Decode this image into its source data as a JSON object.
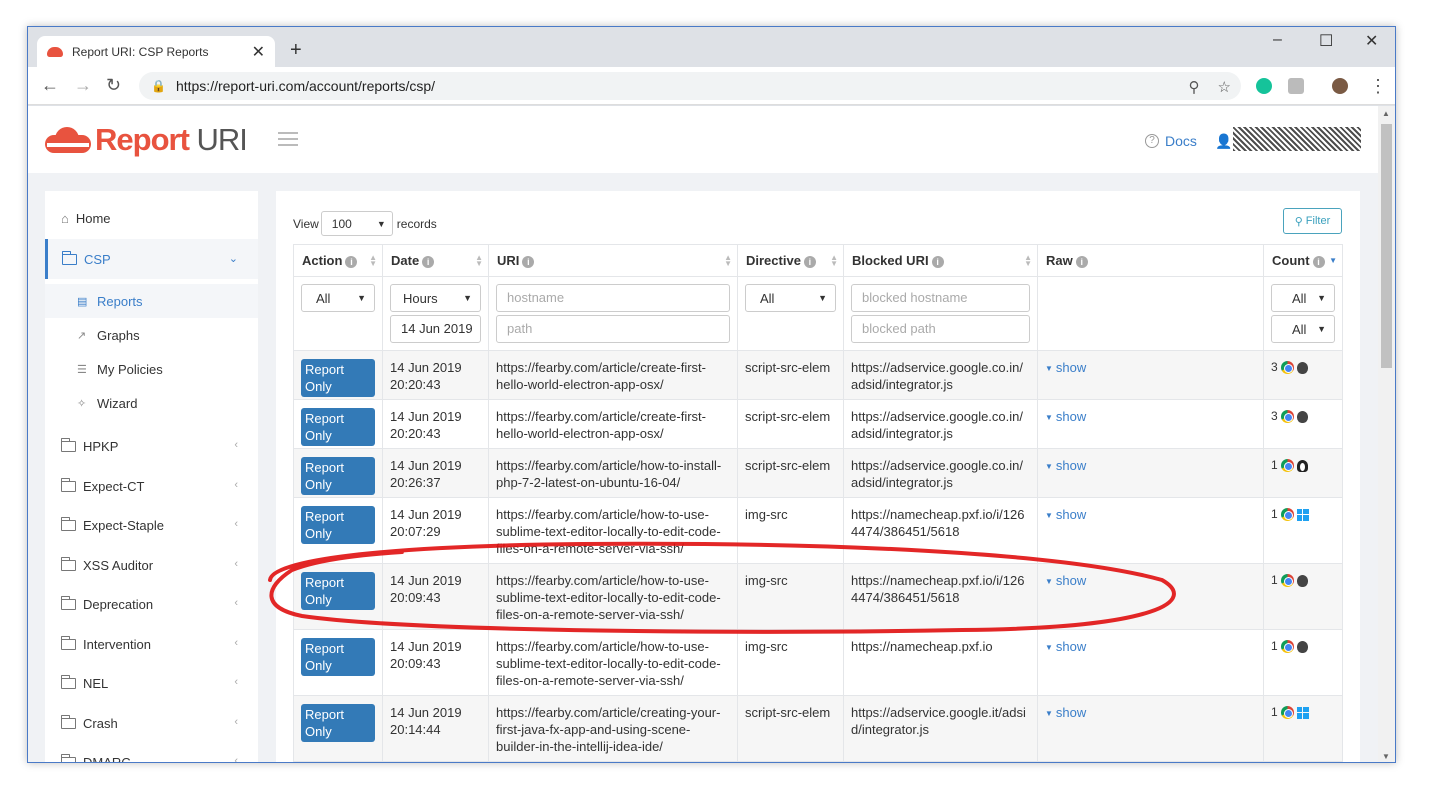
{
  "browser": {
    "tab_title": "Report URI: CSP Reports",
    "url": "https://report-uri.com/account/reports/csp/"
  },
  "header": {
    "brand_report": "Report",
    "brand_uri": " URI",
    "docs_label": "Docs"
  },
  "sidebar": {
    "items": [
      {
        "label": "Home"
      },
      {
        "label": "CSP"
      },
      {
        "label": "HPKP"
      },
      {
        "label": "Expect-CT"
      },
      {
        "label": "Expect-Staple"
      },
      {
        "label": "XSS Auditor"
      },
      {
        "label": "Deprecation"
      },
      {
        "label": "Intervention"
      },
      {
        "label": "NEL"
      },
      {
        "label": "Crash"
      },
      {
        "label": "DMARC"
      }
    ],
    "csp_sub": [
      {
        "label": "Reports"
      },
      {
        "label": "Graphs"
      },
      {
        "label": "My Policies"
      },
      {
        "label": "Wizard"
      }
    ]
  },
  "toolbar": {
    "view_label": "View",
    "view_value": "100",
    "records_label": "records",
    "filter_label": "Filter"
  },
  "table": {
    "columns": [
      "Action",
      "Date",
      "URI",
      "Directive",
      "Blocked URI",
      "Raw",
      "Count"
    ],
    "filters": {
      "action": "All",
      "date_unit": "Hours",
      "date_value": "14 Jun 2019",
      "uri_host_placeholder": "hostname",
      "uri_path_placeholder": "path",
      "directive": "All",
      "blocked_host_placeholder": "blocked hostname",
      "blocked_path_placeholder": "blocked path",
      "count_1": "All",
      "count_2": "All"
    },
    "rows": [
      {
        "action": "Report Only",
        "date": "14 Jun 2019",
        "time": "20:20:43",
        "uri": "https://fearby.com/article/create-first-hello-world-electron-app-osx/",
        "directive": "script-src-elem",
        "blocked": "https://adservice.google.co.in/adsid/integrator.js",
        "raw": "show",
        "count": "3",
        "os": "apple"
      },
      {
        "action": "Report Only",
        "date": "14 Jun 2019",
        "time": "20:20:43",
        "uri": "https://fearby.com/article/create-first-hello-world-electron-app-osx/",
        "directive": "script-src-elem",
        "blocked": "https://adservice.google.co.in/adsid/integrator.js",
        "raw": "show",
        "count": "3",
        "os": "apple"
      },
      {
        "action": "Report Only",
        "date": "14 Jun 2019",
        "time": "20:26:37",
        "uri": "https://fearby.com/article/how-to-install-php-7-2-latest-on-ubuntu-16-04/",
        "directive": "script-src-elem",
        "blocked": "https://adservice.google.co.in/adsid/integrator.js",
        "raw": "show",
        "count": "1",
        "os": "linux"
      },
      {
        "action": "Report Only",
        "date": "14 Jun 2019",
        "time": "20:07:29",
        "uri": "https://fearby.com/article/how-to-use-sublime-text-editor-locally-to-edit-code-files-on-a-remote-server-via-ssh/",
        "directive": "img-src",
        "blocked": "https://namecheap.pxf.io/i/1264474/386451/5618",
        "raw": "show",
        "count": "1",
        "os": "windows"
      },
      {
        "action": "Report Only",
        "date": "14 Jun 2019",
        "time": "20:09:43",
        "uri": "https://fearby.com/article/how-to-use-sublime-text-editor-locally-to-edit-code-files-on-a-remote-server-via-ssh/",
        "directive": "img-src",
        "blocked": "https://namecheap.pxf.io/i/1264474/386451/5618",
        "raw": "show",
        "count": "1",
        "os": "apple"
      },
      {
        "action": "Report Only",
        "date": "14 Jun 2019",
        "time": "20:09:43",
        "uri": "https://fearby.com/article/how-to-use-sublime-text-editor-locally-to-edit-code-files-on-a-remote-server-via-ssh/",
        "directive": "img-src",
        "blocked": "https://namecheap.pxf.io",
        "raw": "show",
        "count": "1",
        "os": "apple"
      },
      {
        "action": "Report Only",
        "date": "14 Jun 2019",
        "time": "20:14:44",
        "uri": "https://fearby.com/article/creating-your-first-java-fx-app-and-using-scene-builder-in-the-intellij-idea-ide/",
        "directive": "script-src-elem",
        "blocked": "https://adservice.google.it/adsid/integrator.js",
        "raw": "show",
        "count": "1",
        "os": "windows"
      }
    ]
  },
  "colors": {
    "brand": "#e8533f",
    "accent": "#3a7ec9",
    "badge": "#337ab7",
    "annotation": "#e01010"
  }
}
